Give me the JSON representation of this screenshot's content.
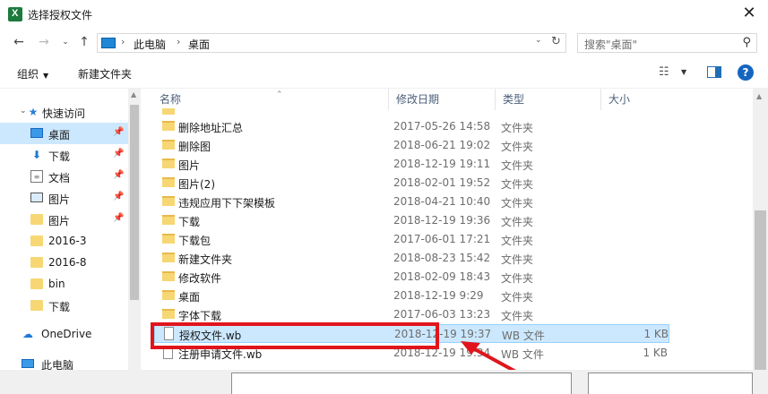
{
  "window": {
    "title": "选择授权文件",
    "close_glyph": "✕"
  },
  "nav": {
    "back_glyph": "←",
    "forward_glyph": "→",
    "recent_glyph": "⌄",
    "up_glyph": "↑",
    "breadcrumb": [
      "此电脑",
      "桌面"
    ],
    "crumb_separator": "›",
    "search_placeholder": "搜索\"桌面\""
  },
  "toolbar": {
    "organize": "组织",
    "new_folder": "新建文件夹"
  },
  "sidebar": {
    "quick_access": "快速访问",
    "items": [
      {
        "label": "桌面",
        "icon": "desktop-icon",
        "pinned": true,
        "selected": true
      },
      {
        "label": "下载",
        "icon": "download-icon",
        "pinned": true
      },
      {
        "label": "文档",
        "icon": "document-icon",
        "pinned": true
      },
      {
        "label": "图片",
        "icon": "pictures-icon",
        "pinned": true
      },
      {
        "label": "图片",
        "icon": "folder-icon",
        "pinned": true
      },
      {
        "label": "2016-3",
        "icon": "folder-icon"
      },
      {
        "label": "2016-8",
        "icon": "folder-icon"
      },
      {
        "label": "bin",
        "icon": "folder-icon"
      },
      {
        "label": "下载",
        "icon": "folder-icon"
      }
    ],
    "onedrive": "OneDrive",
    "this_pc": "此电脑"
  },
  "columns": {
    "name": "名称",
    "date": "修改日期",
    "type": "类型",
    "size": "大小"
  },
  "files": [
    {
      "name": "删除地址汇总",
      "date": "2017-05-26 14:58",
      "type": "文件夹",
      "size": "",
      "kind": "folder"
    },
    {
      "name": "删除图",
      "date": "2018-06-21 19:02",
      "type": "文件夹",
      "size": "",
      "kind": "folder"
    },
    {
      "name": "图片",
      "date": "2018-12-19 19:11",
      "type": "文件夹",
      "size": "",
      "kind": "folder"
    },
    {
      "name": "图片(2)",
      "date": "2018-02-01 19:52",
      "type": "文件夹",
      "size": "",
      "kind": "folder"
    },
    {
      "name": "违规应用下下架模板",
      "date": "2018-04-21 10:40",
      "type": "文件夹",
      "size": "",
      "kind": "folder"
    },
    {
      "name": "下载",
      "date": "2018-12-19 19:36",
      "type": "文件夹",
      "size": "",
      "kind": "folder"
    },
    {
      "name": "下载包",
      "date": "2017-06-01 17:21",
      "type": "文件夹",
      "size": "",
      "kind": "folder"
    },
    {
      "name": "新建文件夹",
      "date": "2018-08-23 15:42",
      "type": "文件夹",
      "size": "",
      "kind": "folder"
    },
    {
      "name": "修改软件",
      "date": "2018-02-09 18:43",
      "type": "文件夹",
      "size": "",
      "kind": "folder"
    },
    {
      "name": "桌面",
      "date": "2018-12-19 9:29",
      "type": "文件夹",
      "size": "",
      "kind": "folder"
    },
    {
      "name": "字体下载",
      "date": "2017-06-03 13:23",
      "type": "文件夹",
      "size": "",
      "kind": "folder"
    },
    {
      "name": "授权文件.wb",
      "date": "2018-12-19 19:37",
      "type": "WB 文件",
      "size": "1 KB",
      "kind": "file",
      "selected": true
    },
    {
      "name": "注册申请文件.wb",
      "date": "2018-12-19 19:34",
      "type": "WB 文件",
      "size": "1 KB",
      "kind": "file"
    }
  ],
  "colors": {
    "selection": "#cce8ff",
    "annotation": "#e0151c",
    "accent": "#1565c0"
  }
}
